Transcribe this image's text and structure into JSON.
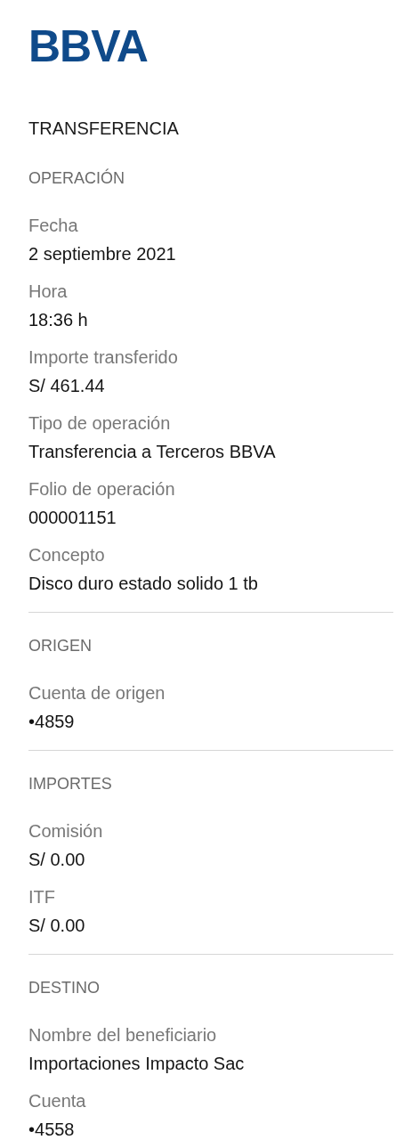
{
  "logo": "BBVA",
  "title": "TRANSFERENCIA",
  "sections": [
    {
      "heading": "OPERACIÓN",
      "fields": [
        {
          "label": "Fecha",
          "value": "2 septiembre 2021"
        },
        {
          "label": "Hora",
          "value": "18:36 h"
        },
        {
          "label": "Importe transferido",
          "value": "S/ 461.44"
        },
        {
          "label": "Tipo de operación",
          "value": "Transferencia a Terceros BBVA"
        },
        {
          "label": "Folio de operación",
          "value": "000001151"
        },
        {
          "label": "Concepto",
          "value": "Disco duro estado solido 1 tb"
        }
      ]
    },
    {
      "heading": "ORIGEN",
      "fields": [
        {
          "label": "Cuenta de origen",
          "value": "•4859"
        }
      ]
    },
    {
      "heading": "IMPORTES",
      "fields": [
        {
          "label": "Comisión",
          "value": "S/ 0.00"
        },
        {
          "label": "ITF",
          "value": "S/ 0.00"
        }
      ]
    },
    {
      "heading": "DESTINO",
      "fields": [
        {
          "label": "Nombre del beneficiario",
          "value": "Importaciones Impacto Sac"
        },
        {
          "label": "Cuenta",
          "value": "•4558"
        }
      ]
    }
  ]
}
